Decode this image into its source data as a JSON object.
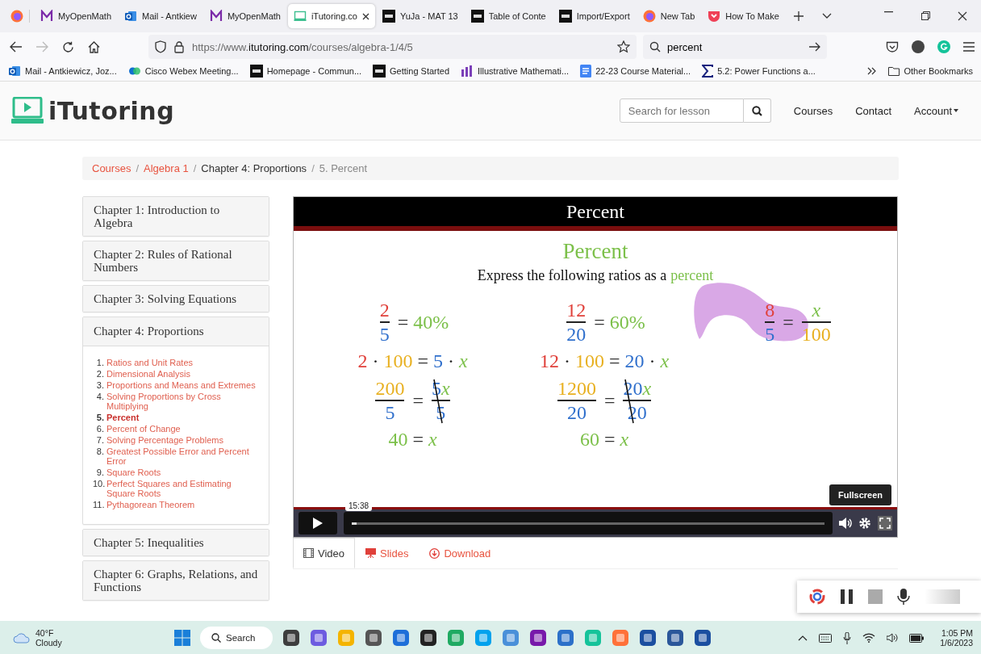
{
  "browser": {
    "tabs": [
      {
        "title": "MyOpenMath",
        "kind": "m",
        "selected": false
      },
      {
        "title": "Mail - Antkiew",
        "kind": "outlook",
        "selected": false
      },
      {
        "title": "MyOpenMath",
        "kind": "m",
        "selected": false
      },
      {
        "title": "iTutoring.co",
        "kind": "itutoring",
        "selected": true
      },
      {
        "title": "YuJa - MAT 13",
        "kind": "d2l",
        "selected": false
      },
      {
        "title": "Table of Conte",
        "kind": "d2l",
        "selected": false
      },
      {
        "title": "Import/Export",
        "kind": "d2l",
        "selected": false
      },
      {
        "title": "New Tab",
        "kind": "firefox",
        "selected": false
      },
      {
        "title": "How To Make",
        "kind": "pocket",
        "selected": false
      }
    ],
    "url": {
      "prefix": "https://www.",
      "domain": "itutoring.com",
      "path": "/courses/algebra-1/4/5"
    },
    "search": {
      "value": "percent"
    },
    "bookmarks": [
      {
        "label": "Mail - Antkiewicz, Joz...",
        "kind": "outlook"
      },
      {
        "label": "Cisco Webex Meeting...",
        "kind": "webex"
      },
      {
        "label": "Homepage - Commun...",
        "kind": "d2l"
      },
      {
        "label": "Getting Started",
        "kind": "d2l"
      },
      {
        "label": "Illustrative Mathemati...",
        "kind": "im"
      },
      {
        "label": "22-23 Course Material...",
        "kind": "docs"
      },
      {
        "label": "5.2: Power Functions a...",
        "kind": "sigma"
      }
    ],
    "other_bookmarks": "Other Bookmarks"
  },
  "site": {
    "logo": "iTutoring",
    "search": {
      "placeholder": "Search for lesson"
    },
    "nav": [
      {
        "label": "Courses",
        "dropdown": false
      },
      {
        "label": "Contact",
        "dropdown": false
      },
      {
        "label": "Account",
        "dropdown": true
      }
    ]
  },
  "breadcrumb": {
    "separator": "/",
    "items": [
      {
        "label": "Courses",
        "kind": "link"
      },
      {
        "label": "Algebra 1",
        "kind": "link"
      },
      {
        "label": "Chapter 4: Proportions",
        "kind": "text"
      },
      {
        "label": "5. Percent",
        "kind": "current"
      }
    ]
  },
  "sidebar": {
    "chapters": [
      {
        "title": "Chapter 1: Introduction to Algebra",
        "expanded": false
      },
      {
        "title": "Chapter 2: Rules of Rational Numbers",
        "expanded": false
      },
      {
        "title": "Chapter 3: Solving Equations",
        "expanded": false
      },
      {
        "title": "Chapter 4: Proportions",
        "expanded": true,
        "lessons": [
          {
            "number": "1.",
            "title": "Ratios and Unit Rates",
            "selected": false
          },
          {
            "number": "2.",
            "title": "Dimensional Analysis",
            "selected": false
          },
          {
            "number": "3.",
            "title": "Proportions and Means and Extremes",
            "selected": false
          },
          {
            "number": "4.",
            "title": "Solving Proportions by Cross Multiplying",
            "selected": false
          },
          {
            "number": "5.",
            "title": "Percent",
            "selected": true
          },
          {
            "number": "6.",
            "title": "Percent of Change",
            "selected": false
          },
          {
            "number": "7.",
            "title": "Solving Percentage Problems",
            "selected": false
          },
          {
            "number": "8.",
            "title": "Greatest Possible Error and Percent Error",
            "selected": false
          },
          {
            "number": "9.",
            "title": "Square Roots",
            "selected": false
          },
          {
            "number": "10.",
            "title": "Perfect Squares and Estimating Square Roots",
            "selected": false
          },
          {
            "number": "11.",
            "title": "Pythagorean Theorem",
            "selected": false
          }
        ]
      },
      {
        "title": "Chapter 5: Inequalities",
        "expanded": false
      },
      {
        "title": "Chapter 6: Graphs, Relations, and Functions",
        "expanded": false
      }
    ]
  },
  "video": {
    "title": "Percent",
    "heading": "Percent",
    "subtitle": "Express the following ratios as a",
    "subtitle_highlight": "percent",
    "columns": [
      {
        "highlighted": false,
        "rows": [
          {
            "terms": [
              {
                "kind": "frac",
                "num": [
                  {
                    "text": "2",
                    "color": "#e0403a"
                  }
                ],
                "den": [
                  {
                    "text": "5",
                    "color": "#2f6fcc"
                  }
                ]
              },
              {
                "text": "=",
                "color": "#333333"
              },
              {
                "text": "40%",
                "color": "#7cc04a"
              }
            ]
          },
          {
            "terms": [
              {
                "text": "2",
                "color": "#e0403a"
              },
              {
                "text": "·"
              },
              {
                "text": "100",
                "color": "#e8b020"
              },
              {
                "text": "=",
                "color": "#333333"
              },
              {
                "text": "5",
                "color": "#2f6fcc"
              },
              {
                "text": "·"
              },
              {
                "text": "x",
                "color": "#7cc04a",
                "italic": true
              }
            ]
          },
          {
            "terms": [
              {
                "kind": "frac",
                "num": [
                  {
                    "text": "200",
                    "color": "#e8b020"
                  }
                ],
                "den": [
                  {
                    "text": "5",
                    "color": "#2f6fcc"
                  }
                ]
              },
              {
                "text": "=",
                "color": "#333333"
              },
              {
                "kind": "frac",
                "struck": true,
                "num": [
                  {
                    "text": "5",
                    "color": "#2f6fcc"
                  },
                  {
                    "text": "x",
                    "color": "#7cc04a",
                    "italic": true
                  }
                ],
                "den": [
                  {
                    "text": "5",
                    "color": "#2f6fcc"
                  }
                ]
              }
            ]
          },
          {
            "terms": [
              {
                "text": "40",
                "color": "#7cc04a"
              },
              {
                "text": "=",
                "color": "#333333"
              },
              {
                "text": "x",
                "color": "#7cc04a",
                "italic": true
              }
            ]
          }
        ]
      },
      {
        "highlighted": false,
        "rows": [
          {
            "terms": [
              {
                "kind": "frac",
                "num": [
                  {
                    "text": "12",
                    "color": "#e0403a"
                  }
                ],
                "den": [
                  {
                    "text": "20",
                    "color": "#2f6fcc"
                  }
                ]
              },
              {
                "text": "=",
                "color": "#333333"
              },
              {
                "text": "60%",
                "color": "#7cc04a"
              }
            ]
          },
          {
            "terms": [
              {
                "text": "12",
                "color": "#e0403a"
              },
              {
                "text": "·"
              },
              {
                "text": "100",
                "color": "#e8b020"
              },
              {
                "text": "=",
                "color": "#333333"
              },
              {
                "text": "20",
                "color": "#2f6fcc"
              },
              {
                "text": "·"
              },
              {
                "text": "x",
                "color": "#7cc04a",
                "italic": true
              }
            ]
          },
          {
            "terms": [
              {
                "kind": "frac",
                "num": [
                  {
                    "text": "1200",
                    "color": "#e8b020"
                  }
                ],
                "den": [
                  {
                    "text": "20",
                    "color": "#2f6fcc"
                  }
                ]
              },
              {
                "text": "=",
                "color": "#333333"
              },
              {
                "kind": "frac",
                "struck": true,
                "num": [
                  {
                    "text": "20",
                    "color": "#2f6fcc"
                  },
                  {
                    "text": "x",
                    "color": "#7cc04a",
                    "italic": true
                  }
                ],
                "den": [
                  {
                    "text": "20",
                    "color": "#2f6fcc"
                  }
                ]
              }
            ]
          },
          {
            "terms": [
              {
                "text": "60",
                "color": "#7cc04a"
              },
              {
                "text": "=",
                "color": "#333333"
              },
              {
                "text": "x",
                "color": "#7cc04a",
                "italic": true
              }
            ]
          }
        ]
      },
      {
        "highlighted": true,
        "rows": [
          {
            "terms": [
              {
                "kind": "frac",
                "num": [
                  {
                    "text": "8",
                    "color": "#e0403a"
                  }
                ],
                "den": [
                  {
                    "text": "5",
                    "color": "#2f6fcc"
                  }
                ]
              },
              {
                "text": "=",
                "color": "#333333"
              },
              {
                "kind": "frac",
                "num": [
                  {
                    "text": "x",
                    "color": "#7cc04a",
                    "italic": true
                  }
                ],
                "den": [
                  {
                    "text": "100",
                    "color": "#e8b020"
                  }
                ]
              }
            ]
          }
        ]
      }
    ],
    "hover_time": "15:38",
    "progress": {
      "level": 0.01
    },
    "tooltip": "Fullscreen"
  },
  "media_tabs": [
    {
      "label": "Video",
      "kind": "film",
      "selected": true
    },
    {
      "label": "Slides",
      "kind": "slides",
      "selected": false
    },
    {
      "label": "Download",
      "kind": "download",
      "selected": false
    }
  ],
  "taskbar": {
    "temperature": "40°F",
    "weather": "Cloudy",
    "search": "Search",
    "time": "1:05 PM",
    "date": "1/6/2023"
  }
}
